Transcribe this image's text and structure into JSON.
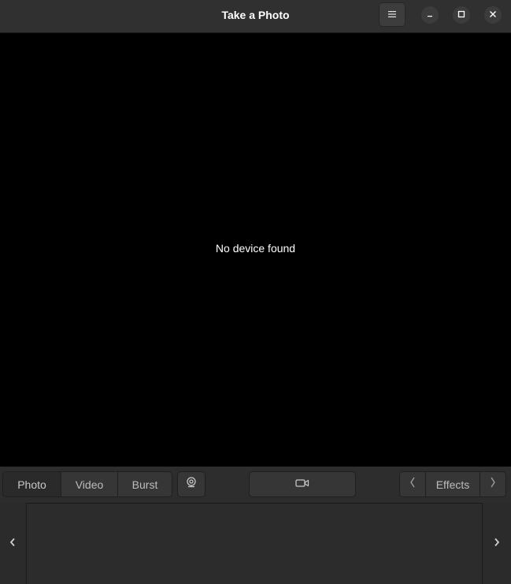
{
  "window": {
    "title": "Take a Photo"
  },
  "headerbar": {
    "menu_icon": "hamburger-menu-icon",
    "minimize_icon": "minimize-icon",
    "maximize_icon": "maximize-icon",
    "close_icon": "close-icon"
  },
  "viewport": {
    "message": "No device found"
  },
  "toolbar": {
    "modes": [
      {
        "label": "Photo",
        "active": true
      },
      {
        "label": "Video",
        "active": false
      },
      {
        "label": "Burst",
        "active": false
      }
    ],
    "webcam_icon": "webcam-icon",
    "shutter_icon": "video-camera-icon",
    "effects": {
      "label": "Effects",
      "prev_icon": "chevron-left-icon",
      "next_icon": "chevron-right-icon"
    }
  },
  "strip": {
    "prev_icon": "chevron-left-icon",
    "next_icon": "chevron-right-icon"
  },
  "colors": {
    "viewport_bg": "#000000",
    "headerbar_bg": "#303030",
    "button_bg": "#363636",
    "text": "#ffffff"
  }
}
